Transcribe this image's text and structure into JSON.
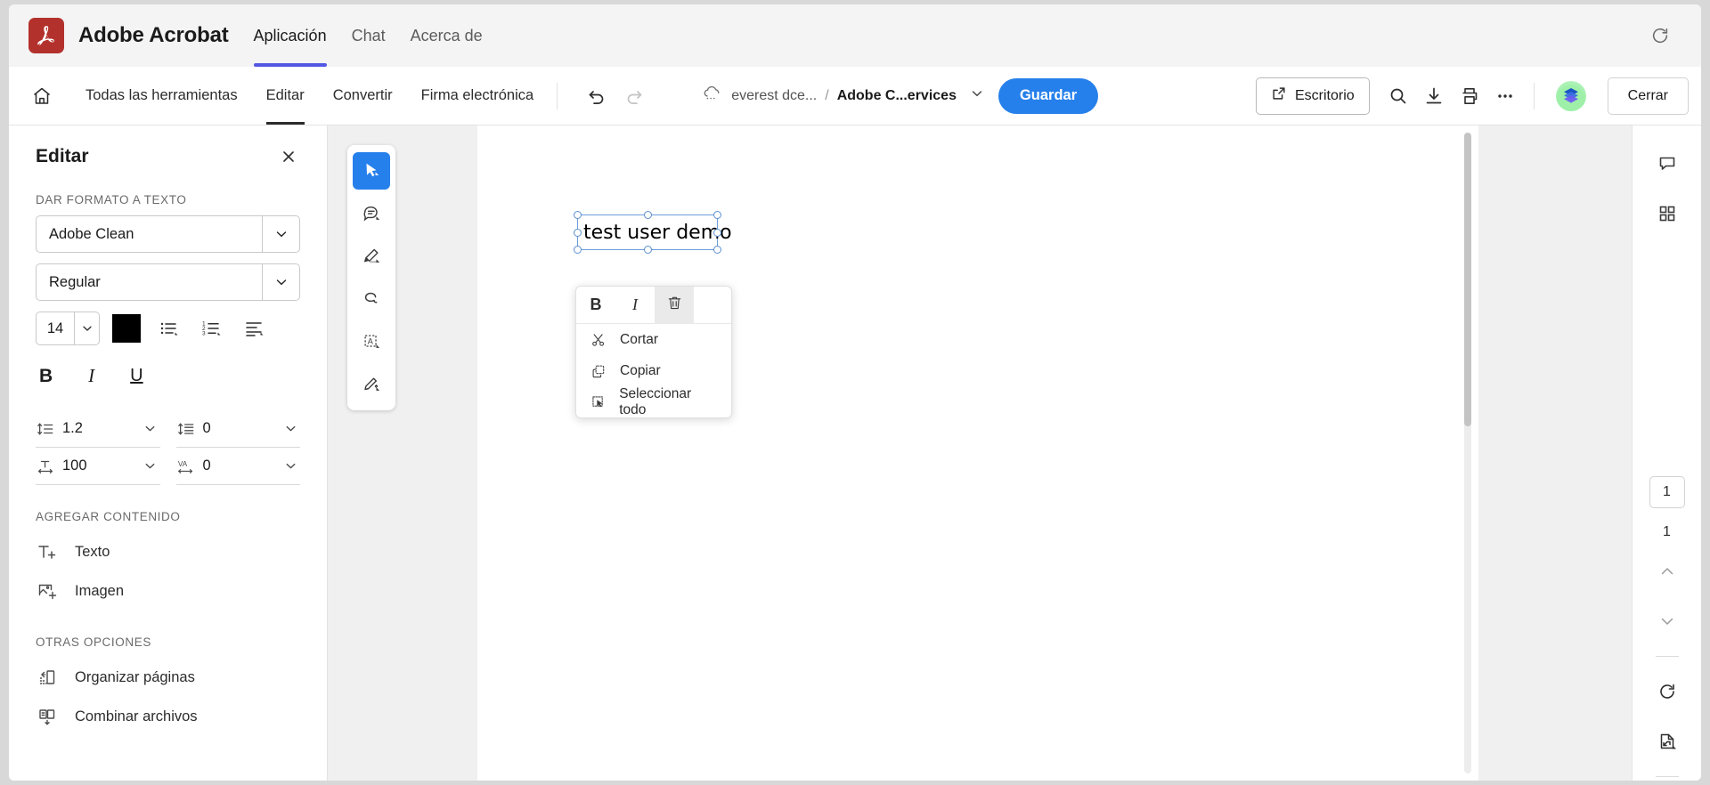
{
  "appbar": {
    "brand": "Adobe Acrobat",
    "nav": [
      {
        "label": "Aplicación",
        "active": true
      },
      {
        "label": "Chat",
        "active": false
      },
      {
        "label": "Acerca de",
        "active": false
      }
    ],
    "refresh_icon": "refresh-icon"
  },
  "toolbar": {
    "home_icon": "home-icon",
    "menu": [
      {
        "label": "Todas las herramientas",
        "active": false
      },
      {
        "label": "Editar",
        "active": true
      },
      {
        "label": "Convertir",
        "active": false
      },
      {
        "label": "Firma electrónica",
        "active": false
      }
    ],
    "undo_icon": "undo-icon",
    "redo_icon": "redo-icon",
    "cloud_icon": "cloud-icon",
    "breadcrumb_account": "everest dce...",
    "breadcrumb_separator": "/",
    "breadcrumb_document": "Adobe C...ervices",
    "breadcrumb_chevron": "chevron-down-icon",
    "save_label": "Guardar",
    "desktop_label": "Escritorio",
    "desktop_icon": "external-link-icon",
    "search_icon": "search-icon",
    "download_icon": "download-icon",
    "print_icon": "print-icon",
    "more_icon": "more-options-icon",
    "avatar": "user-avatar",
    "close_label": "Cerrar"
  },
  "left_panel": {
    "title": "Editar",
    "close_icon": "close-icon",
    "section_format": "DAR FORMATO A TEXTO",
    "font_family": "Adobe Clean",
    "font_style": "Regular",
    "font_size": "14",
    "color_hex": "#000000",
    "bullet_list_icon": "bullet-list-icon",
    "numbered_list_icon": "numbered-list-icon",
    "align_icon": "text-align-icon",
    "bold_label": "B",
    "italic_label": "I",
    "underline_label": "U",
    "line_spacing_value": "1.2",
    "paragraph_spacing_value": "0",
    "horizontal_scale_value": "100",
    "tracking_value": "0",
    "line_spacing_icon": "line-spacing-icon",
    "paragraph_spacing_icon": "paragraph-spacing-icon",
    "horizontal_scale_icon": "horizontal-scale-icon",
    "tracking_icon": "tracking-icon",
    "section_add": "AGREGAR CONTENIDO",
    "add_items": [
      {
        "label": "Texto",
        "icon": "add-text-icon"
      },
      {
        "label": "Imagen",
        "icon": "add-image-icon"
      }
    ],
    "section_other": "OTRAS OPCIONES",
    "other_items": [
      {
        "label": "Organizar páginas",
        "icon": "organize-pages-icon"
      },
      {
        "label": "Combinar archivos",
        "icon": "combine-files-icon"
      }
    ]
  },
  "tool_strip": [
    {
      "name": "select-tool",
      "icon": "cursor-icon",
      "active": true
    },
    {
      "name": "comment-tool",
      "icon": "comment-bubble-icon",
      "active": false
    },
    {
      "name": "highlight-tool",
      "icon": "highlighter-icon",
      "active": false
    },
    {
      "name": "draw-tool",
      "icon": "lasso-icon",
      "active": false
    },
    {
      "name": "text-box-tool",
      "icon": "text-field-icon",
      "active": false
    },
    {
      "name": "sign-tool",
      "icon": "signature-pen-icon",
      "active": false
    }
  ],
  "document": {
    "text_object": "test user demo",
    "context_menu": {
      "bold_label": "B",
      "italic_label": "I",
      "delete_icon": "trash-icon",
      "items": [
        {
          "label": "Cortar",
          "icon": "scissors-icon"
        },
        {
          "label": "Copiar",
          "icon": "copy-icon"
        },
        {
          "label": "Seleccionar todo",
          "icon": "select-all-icon"
        }
      ]
    }
  },
  "right_rail": {
    "comment_icon": "comment-panel-icon",
    "thumbnails_icon": "page-thumbnails-icon",
    "current_page": "1",
    "total_pages": "1",
    "prev_icon": "chevron-up-icon",
    "next_icon": "chevron-down-icon",
    "rotate_icon": "rotate-icon",
    "fit_icon": "fit-page-icon"
  },
  "colors": {
    "brand_red": "#b3312c",
    "accent_blue": "#2680eb",
    "tab_indicator": "#5258e4",
    "selection_blue": "#6d9eda"
  }
}
